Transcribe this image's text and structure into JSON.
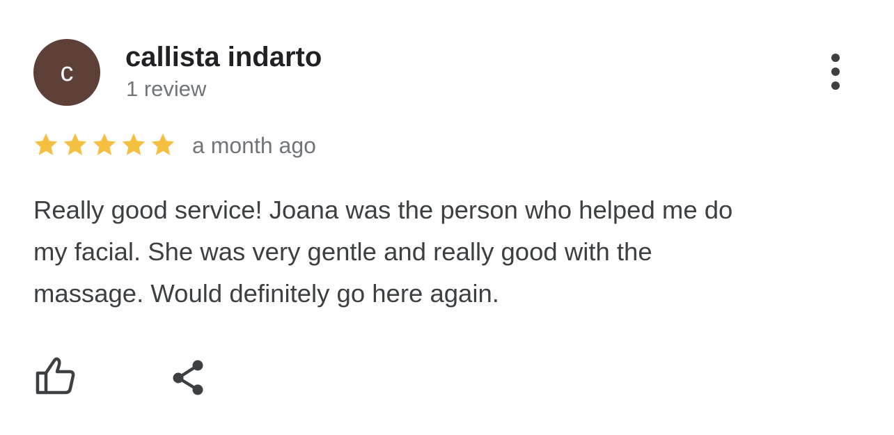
{
  "review": {
    "avatar_initial": "c",
    "avatar_color": "#5d4037",
    "author": "callista indarto",
    "review_count": "1 review",
    "rating": 5,
    "rating_max": 5,
    "star_color": "#f4c042",
    "date": "a month ago",
    "lines": [
      "Really good service! Joana was the person who helped me do",
      "my facial. She was very gentle and really good with the",
      "massage. Would definitely go here again."
    ]
  },
  "actions": {
    "more_icon": "more-vert-icon",
    "like_icon": "thumb-up-icon",
    "share_icon": "share-icon"
  }
}
